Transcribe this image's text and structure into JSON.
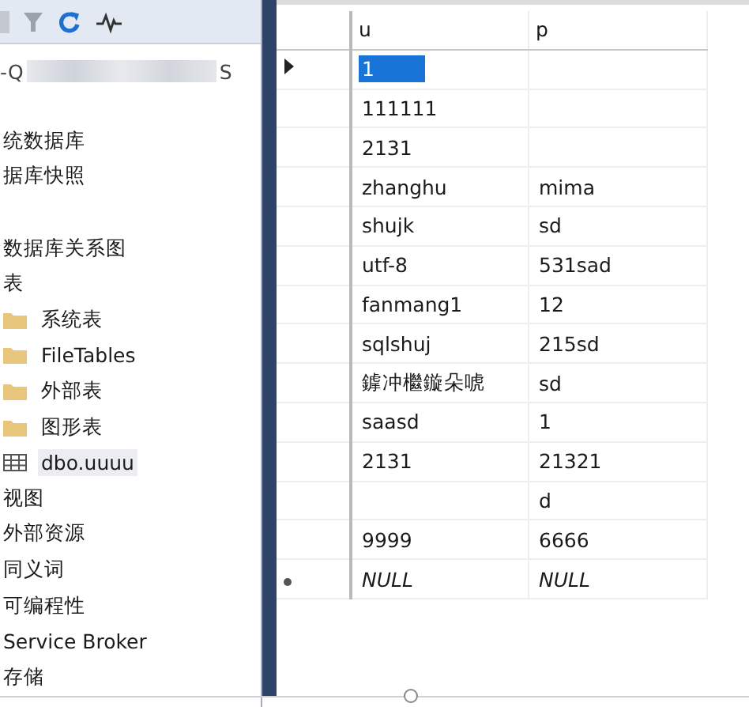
{
  "explorer": {
    "server_name": {
      "start": "-Q",
      "end": "S"
    },
    "tree": [
      {
        "label": "统数据库",
        "kind": "plain",
        "selected": false
      },
      {
        "label": "据库快照",
        "kind": "plain",
        "selected": false
      },
      {
        "kind": "blank"
      },
      {
        "label": "数据库关系图",
        "kind": "plain",
        "selected": false
      },
      {
        "label": "表",
        "kind": "plain",
        "selected": false,
        "children": [
          {
            "label": "系统表",
            "kind": "folder",
            "selected": false
          },
          {
            "label": "FileTables",
            "kind": "folder",
            "selected": false
          },
          {
            "label": "外部表",
            "kind": "folder",
            "selected": false
          },
          {
            "label": "图形表",
            "kind": "folder",
            "selected": false
          },
          {
            "label": "dbo.uuuu",
            "kind": "table",
            "selected": true
          }
        ]
      },
      {
        "label": "视图",
        "kind": "plain",
        "selected": false
      },
      {
        "label": "外部资源",
        "kind": "plain",
        "selected": false
      },
      {
        "label": "同义词",
        "kind": "plain",
        "selected": false
      },
      {
        "label": "可编程性",
        "kind": "plain",
        "selected": false
      },
      {
        "label": "Service Broker",
        "kind": "plain",
        "selected": false
      },
      {
        "label": "存储",
        "kind": "plain",
        "selected": false
      }
    ]
  },
  "grid": {
    "columns": [
      "u",
      "p"
    ],
    "rows": [
      {
        "kind": "current",
        "cells": [
          {
            "text": "1",
            "kind": "value",
            "selected": true
          },
          {
            "selected": false
          }
        ]
      },
      {
        "kind": "data",
        "cells": [
          {
            "text": "111111",
            "kind": "value",
            "selected": false
          },
          {
            "selected": false
          }
        ]
      },
      {
        "kind": "data",
        "cells": [
          {
            "text": "2131",
            "kind": "value",
            "selected": false
          },
          {
            "selected": false
          }
        ]
      },
      {
        "kind": "data",
        "cells": [
          {
            "text": "zhanghu",
            "kind": "value",
            "selected": false
          },
          {
            "text": "mima",
            "kind": "value",
            "selected": false
          }
        ]
      },
      {
        "kind": "data",
        "cells": [
          {
            "text": "shujk",
            "kind": "value",
            "selected": false
          },
          {
            "text": "sd",
            "kind": "value",
            "selected": false
          }
        ]
      },
      {
        "kind": "data",
        "cells": [
          {
            "text": "utf-8",
            "kind": "value",
            "selected": false
          },
          {
            "text": "531sad",
            "kind": "value",
            "selected": false
          }
        ]
      },
      {
        "kind": "data",
        "cells": [
          {
            "text": "fanmang1",
            "kind": "value",
            "selected": false
          },
          {
            "text": "12",
            "kind": "value",
            "selected": false
          }
        ]
      },
      {
        "kind": "data",
        "cells": [
          {
            "text": "sqlshuj",
            "kind": "value",
            "selected": false
          },
          {
            "text": "215sd",
            "kind": "value",
            "selected": false
          }
        ]
      },
      {
        "kind": "data",
        "cells": [
          {
            "text": "鎼冲檵鏇朵唬",
            "kind": "value",
            "selected": false
          },
          {
            "text": "sd",
            "kind": "value",
            "selected": false
          }
        ]
      },
      {
        "kind": "data",
        "cells": [
          {
            "text": "saasd",
            "kind": "value",
            "selected": false
          },
          {
            "text": "1",
            "kind": "value",
            "selected": false
          }
        ]
      },
      {
        "kind": "data",
        "cells": [
          {
            "text": "2131",
            "kind": "value",
            "selected": false
          },
          {
            "text": "21321",
            "kind": "value",
            "selected": false
          }
        ]
      },
      {
        "kind": "data",
        "cells": [
          {
            "selected": false
          },
          {
            "text": "d",
            "kind": "value",
            "selected": false
          }
        ]
      },
      {
        "kind": "data",
        "cells": [
          {
            "text": "9999",
            "kind": "value",
            "selected": false
          },
          {
            "text": "6666",
            "kind": "value",
            "selected": false
          }
        ]
      },
      {
        "kind": "new",
        "cells": [
          {
            "text": "NULL",
            "kind": "null",
            "selected": false
          },
          {
            "text": "NULL",
            "kind": "null",
            "selected": false
          }
        ]
      }
    ]
  }
}
